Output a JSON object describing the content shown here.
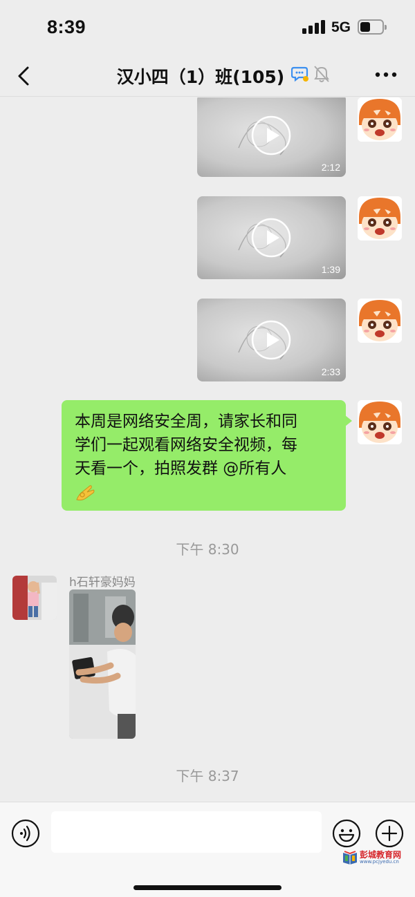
{
  "status_bar": {
    "time": "8:39",
    "network": "5G"
  },
  "nav": {
    "title": "汉小四（1）班(105)"
  },
  "messages": {
    "videos": [
      {
        "duration": "2:12"
      },
      {
        "duration": "1:39"
      },
      {
        "duration": "2:33"
      }
    ],
    "text_message": {
      "lines": [
        "本周是网络安全周，请家长和同",
        "学们一起观看网络安全视频，每",
        "天看一个，拍照发群 @所有人"
      ],
      "emoji": "ok-hand"
    },
    "timestamp_1": "下午 8:30",
    "sender_name": "h石轩豪妈妈",
    "timestamp_2": "下午 8:37"
  },
  "input_bar": {
    "placeholder": ""
  },
  "watermark": {
    "name": "彭城教育网",
    "url": "www.pcjyedu.cn"
  },
  "colors": {
    "background": "#ededed",
    "self_bubble": "#95ec69",
    "timestamp": "#999999",
    "accent_blue": "#3b8ff0"
  },
  "icons": [
    "back-icon",
    "chat-bubble-icon",
    "mute-icon",
    "more-icon",
    "play-icon",
    "voice-icon",
    "emoji-icon",
    "plus-icon"
  ]
}
